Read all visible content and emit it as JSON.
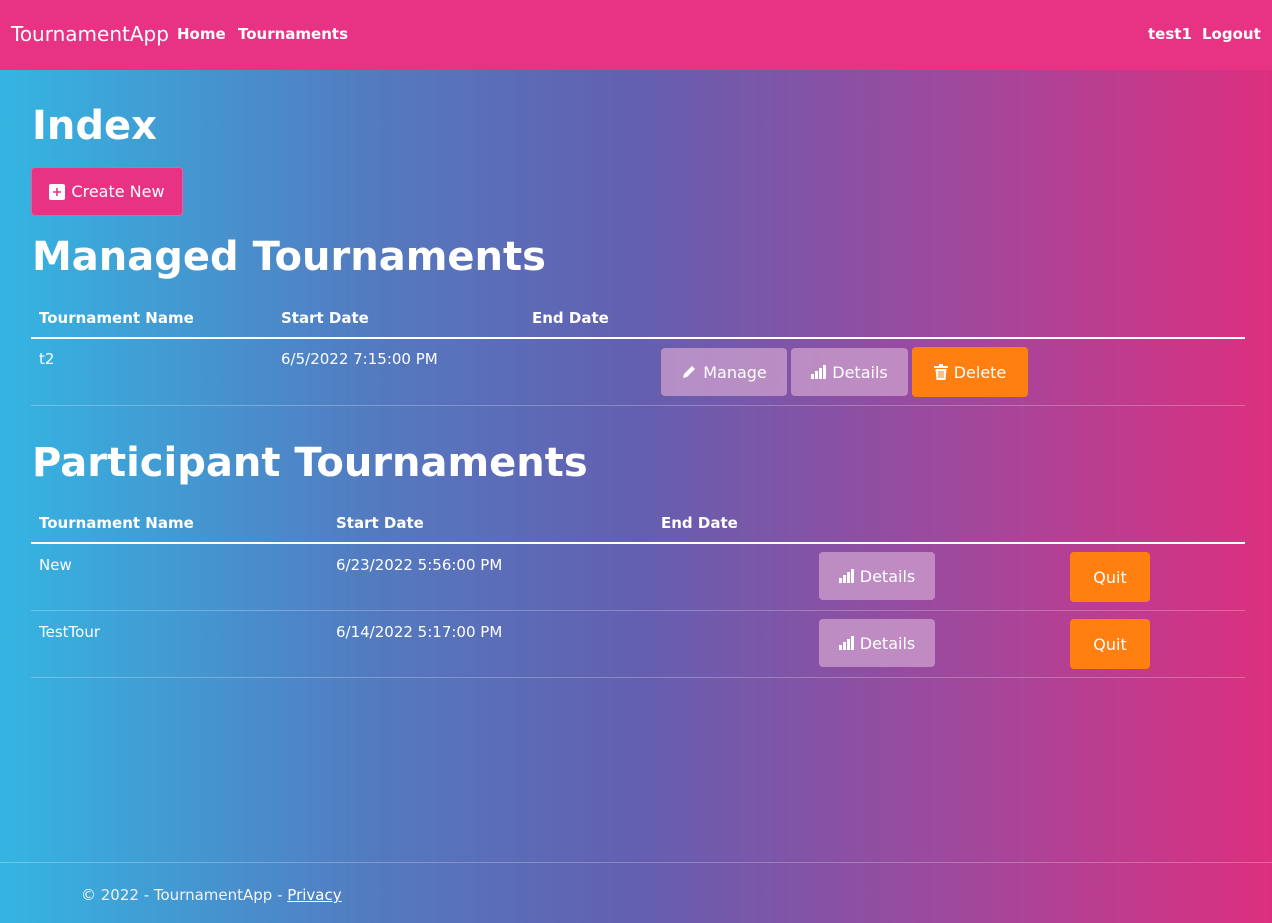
{
  "navbar": {
    "brand": "TournamentApp",
    "links": [
      "Home",
      "Tournaments"
    ],
    "user": "test1",
    "logout": "Logout"
  },
  "page": {
    "title": "Index",
    "create_new": "Create New"
  },
  "managed": {
    "heading": "Managed Tournaments",
    "headers": [
      "Tournament Name",
      "Start Date",
      "End Date"
    ],
    "rows": [
      {
        "name": "t2",
        "start": "6/5/2022 7:15:00 PM",
        "end": "",
        "manage": "Manage",
        "details": "Details",
        "delete": "Delete"
      }
    ]
  },
  "participant": {
    "heading": "Participant Tournaments",
    "headers": [
      "Tournament Name",
      "Start Date",
      "End Date"
    ],
    "rows": [
      {
        "name": "New",
        "start": "6/23/2022 5:56:00 PM",
        "end": "",
        "details": "Details",
        "quit": "Quit"
      },
      {
        "name": "TestTour",
        "start": "6/14/2022 5:17:00 PM",
        "end": "",
        "details": "Details",
        "quit": "Quit"
      }
    ]
  },
  "footer": {
    "copyright": "© 2022 - TournamentApp - ",
    "privacy": "Privacy"
  },
  "colors": {
    "navbar": "#e83385",
    "accent_orange": "#ff7f11",
    "button_lavender": "#c9a0cc",
    "gradient_left": "#34b5e2",
    "gradient_right": "#dd2f7f"
  },
  "icons": {
    "create": "plus-square-icon",
    "manage": "pencil-icon",
    "details": "bar-chart-icon",
    "delete": "trash-icon"
  }
}
